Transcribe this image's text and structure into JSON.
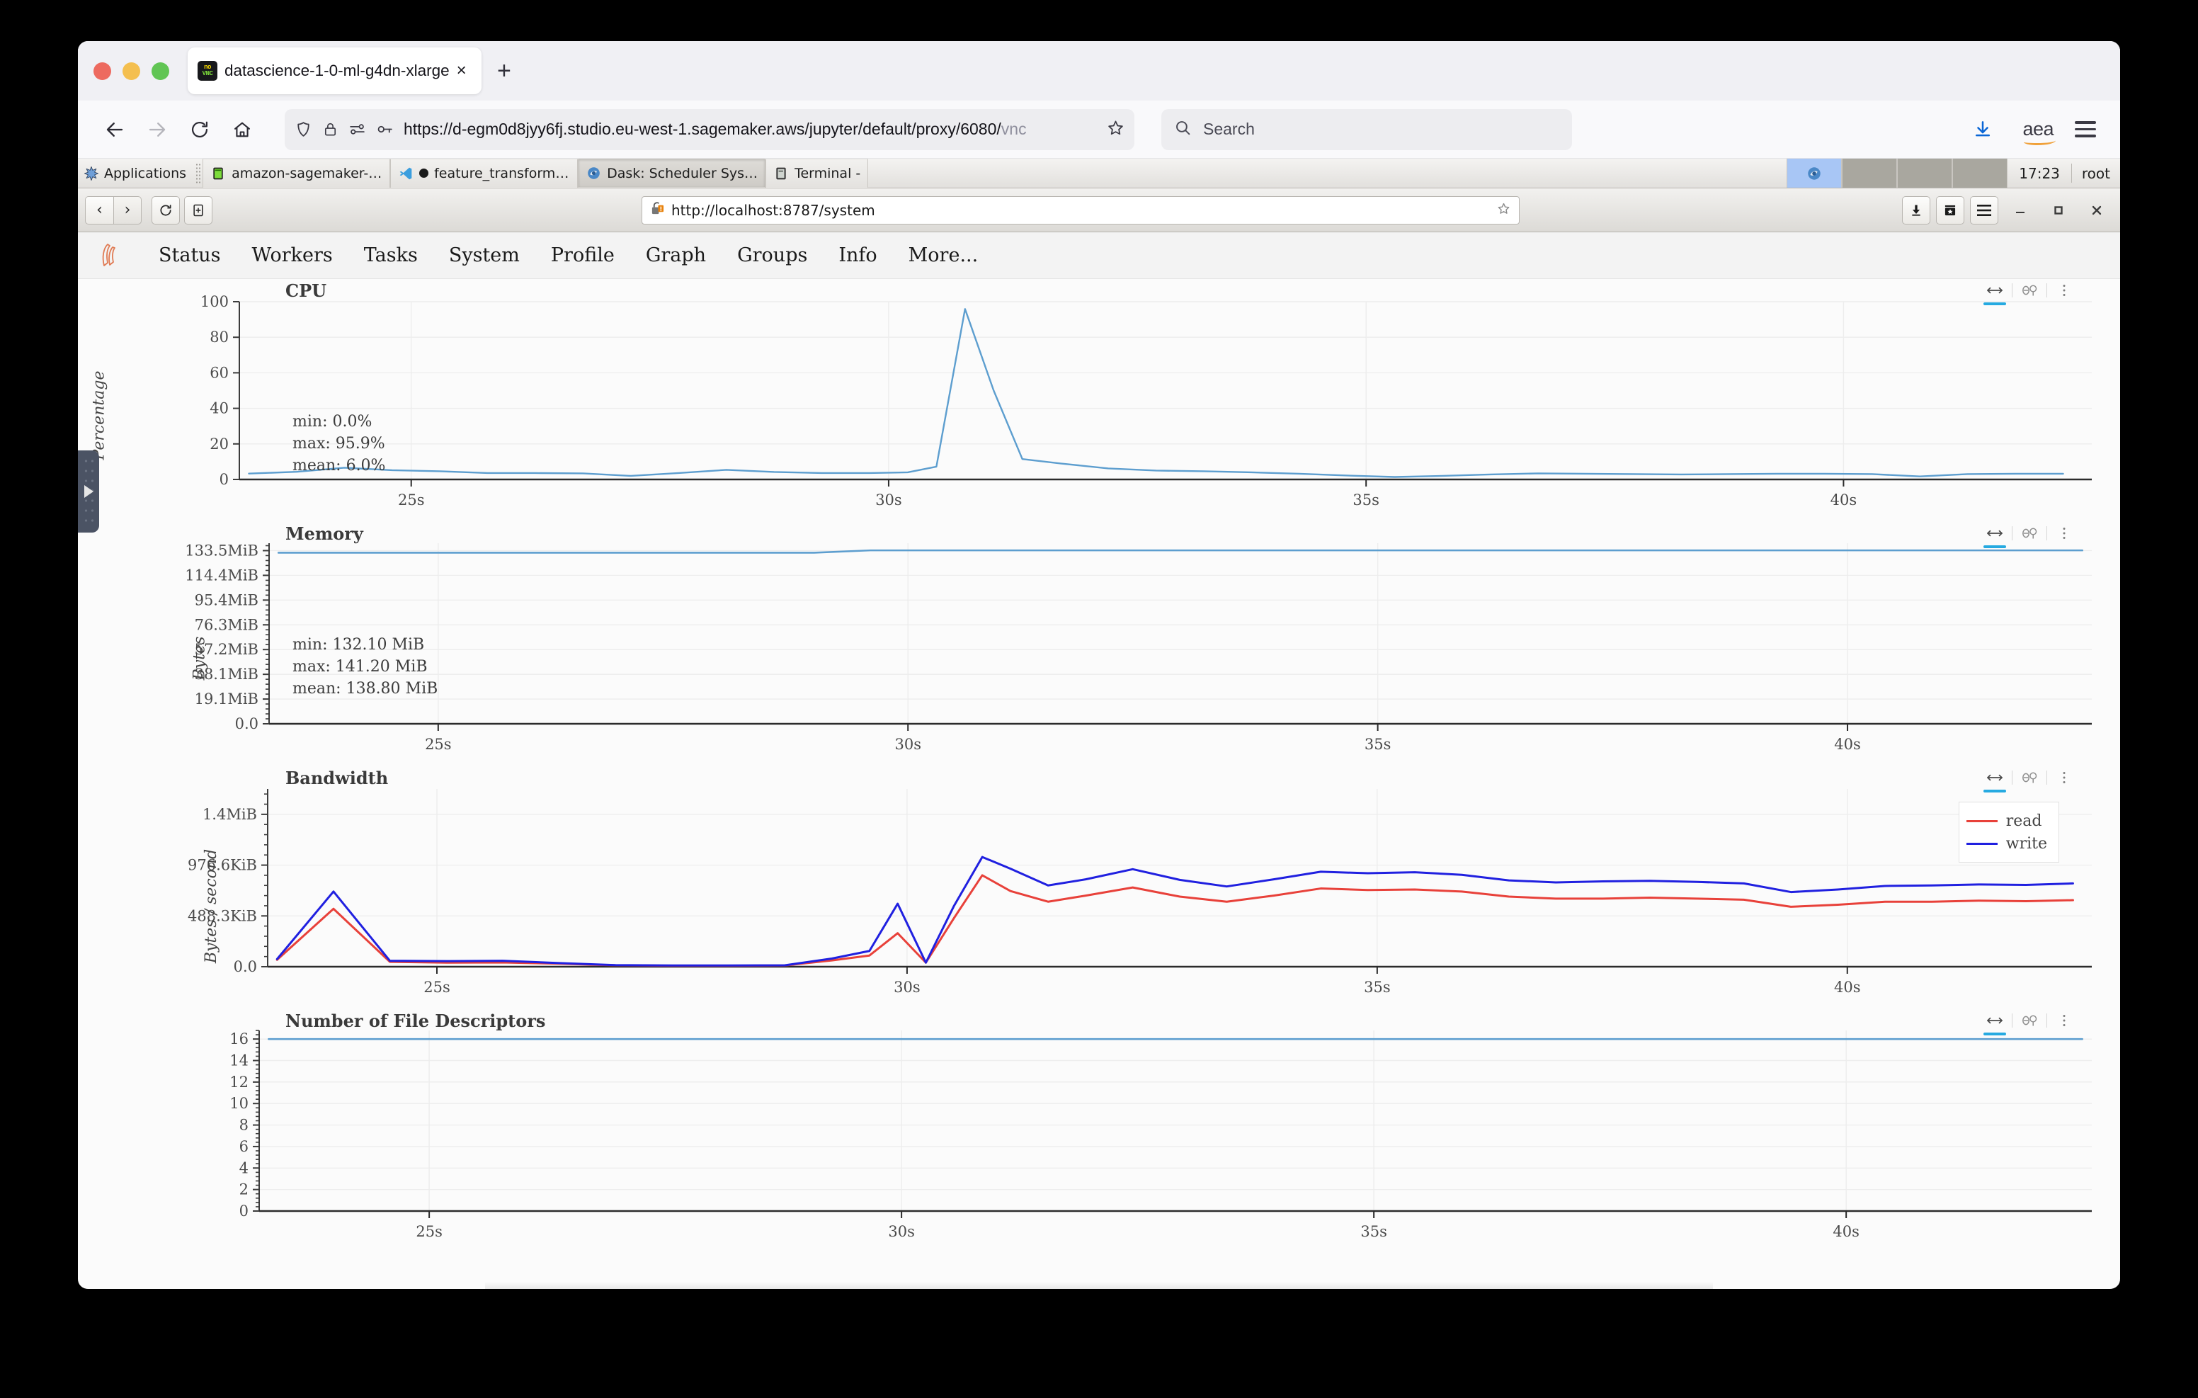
{
  "browser": {
    "tab": {
      "title": "datascience-1-0-ml-g4dn-xlarge",
      "favicon": "novnc-icon",
      "close_label": "×"
    },
    "new_tab_label": "+",
    "nav": {
      "back": "back-icon",
      "forward": "forward-icon",
      "reload": "reload-icon",
      "home": "home-icon"
    },
    "url": {
      "value": "https://d-egm0d8jyy6fj.studio.eu-west-1.sagemaker.aws/jupyter/default/proxy/6080/",
      "value_dim": "vnc",
      "icons": [
        "shield-icon",
        "lock-icon",
        "permissions-icon",
        "key-icon"
      ],
      "bookmark": "star-icon"
    },
    "search": {
      "placeholder": "Search",
      "icon": "search-icon"
    },
    "toolbar_right": {
      "downloads": "download-icon",
      "extension": "aea",
      "menu": "hamburger-icon"
    }
  },
  "desktop": {
    "applications_label": "Applications",
    "tasks": [
      {
        "label": "amazon-sagemaker-exa...",
        "icon": "terminal-icon",
        "active": false
      },
      {
        "label": "feature_transformatio...",
        "icon": "vscode-icon",
        "active": false
      },
      {
        "label": "Dask: Scheduler System...",
        "icon": "firefox-icon",
        "active": true
      },
      {
        "label": "Terminal -",
        "icon": "terminal-icon",
        "active": false
      }
    ],
    "clock": "17:23",
    "user": "root"
  },
  "inner_browser": {
    "buttons": {
      "back": "‹",
      "forward": "›",
      "reload": "↻",
      "new_private": "new-tab-icon",
      "downloads": "download-icon",
      "library": "library-icon",
      "menu": "hamburger-icon",
      "minimize": "minimize-icon",
      "maximize": "maximize-icon",
      "close": "close-icon"
    },
    "url": "http://localhost:8787/system",
    "security_icon": "insecure-lock-icon",
    "bookmark_icon": "star-icon"
  },
  "dask": {
    "logo": "dask-logo",
    "nav_items": [
      "Status",
      "Workers",
      "Tasks",
      "System",
      "Profile",
      "Graph",
      "Groups",
      "Info",
      "More..."
    ],
    "plot_tools": {
      "pan": "pan-tool-icon",
      "reset": "reset-tool-icon",
      "menu": "kebab-menu-icon"
    }
  },
  "chart_data": [
    {
      "type": "line",
      "title": "CPU",
      "xlabel": "",
      "ylabel": "Percentage",
      "ylim": [
        0,
        100
      ],
      "yticks": [
        0,
        20,
        40,
        60,
        80,
        100
      ],
      "ytick_labels": [
        "0",
        "20",
        "40",
        "60",
        "80",
        "100"
      ],
      "xlim": [
        23.2,
        42.6
      ],
      "xticks": [
        25,
        30,
        35,
        40
      ],
      "xtick_labels": [
        "25s",
        "30s",
        "35s",
        "40s"
      ],
      "grid": true,
      "annotations": [
        "min: 0.0%",
        "max: 95.9%",
        "mean: 6.0%"
      ],
      "series": [
        {
          "name": "cpu",
          "color": "#5d9ecf",
          "x": [
            23.3,
            23.8,
            24.3,
            24.8,
            25.3,
            25.8,
            26.3,
            26.8,
            27.3,
            27.8,
            28.3,
            28.8,
            29.3,
            29.8,
            30.2,
            30.5,
            30.8,
            31.1,
            31.4,
            31.8,
            32.3,
            32.8,
            33.3,
            33.8,
            34.3,
            34.8,
            35.3,
            35.8,
            36.3,
            36.8,
            37.3,
            37.8,
            38.3,
            38.8,
            39.3,
            39.8,
            40.3,
            40.8,
            41.3,
            41.8,
            42.3
          ],
          "y": [
            3.3,
            4.3,
            6.6,
            5.2,
            4.6,
            3.6,
            3.6,
            3.4,
            2.0,
            3.6,
            5.4,
            4.2,
            3.6,
            3.6,
            4.0,
            7.2,
            95.9,
            50.0,
            11.5,
            9.0,
            6.2,
            5.0,
            4.6,
            4.0,
            3.2,
            2.2,
            1.4,
            2.0,
            2.8,
            3.4,
            3.2,
            3.0,
            2.8,
            3.0,
            3.2,
            3.2,
            3.0,
            1.7,
            3.0,
            3.2,
            3.2
          ]
        }
      ]
    },
    {
      "type": "line",
      "title": "Memory",
      "xlabel": "",
      "ylabel": "Bytes",
      "ylim": [
        0,
        146000000
      ],
      "yticks": [
        0,
        20000000,
        40000000,
        60000000,
        80000000,
        100000000,
        120000000,
        140000000
      ],
      "ytick_labels": [
        "0.0",
        "19.1MiB",
        "38.1MiB",
        "57.2MiB",
        "76.3MiB",
        "95.4MiB",
        "114.4MiB",
        "133.5MiB"
      ],
      "xticks": [
        25,
        30,
        35,
        40
      ],
      "xtick_labels": [
        "25s",
        "30s",
        "35s",
        "40s"
      ],
      "grid": true,
      "annotations": [
        "min: 132.10 MiB",
        "max: 141.20 MiB",
        "mean: 138.80 MiB"
      ],
      "series": [
        {
          "name": "memory",
          "color": "#5d9ecf",
          "x": [
            23.3,
            29.0,
            29.6,
            42.5
          ],
          "y": [
            138300000,
            138300000,
            140200000,
            140200000
          ]
        }
      ]
    },
    {
      "type": "line",
      "title": "Bandwidth",
      "xlabel": "",
      "ylabel": "Bytes / second",
      "ylim": [
        0,
        1750000
      ],
      "yticks": [
        0,
        500000,
        1000000,
        1500000
      ],
      "ytick_labels": [
        "0.0",
        "488.3KiB",
        "976.6KiB",
        "1.4MiB"
      ],
      "xticks": [
        25,
        30,
        35,
        40
      ],
      "xtick_labels": [
        "25s",
        "30s",
        "35s",
        "40s"
      ],
      "grid": true,
      "legend_position": "top-right",
      "series": [
        {
          "name": "read",
          "color": "#e8413a",
          "x": [
            23.3,
            23.9,
            24.5,
            25.1,
            25.7,
            26.3,
            26.9,
            27.5,
            28.1,
            28.7,
            29.2,
            29.6,
            29.9,
            30.2,
            30.5,
            30.8,
            31.1,
            31.5,
            31.9,
            32.4,
            32.9,
            33.4,
            33.9,
            34.4,
            34.9,
            35.4,
            35.9,
            36.4,
            36.9,
            37.4,
            37.9,
            38.4,
            38.9,
            39.4,
            39.9,
            40.4,
            40.9,
            41.4,
            41.9,
            42.4
          ],
          "y": [
            68000,
            570000,
            48000,
            40000,
            42000,
            30000,
            14000,
            10000,
            10000,
            12000,
            62000,
            110000,
            330000,
            40000,
            480000,
            900000,
            745000,
            640000,
            700000,
            780000,
            690000,
            640000,
            700000,
            770000,
            755000,
            760000,
            740000,
            690000,
            670000,
            670000,
            680000,
            670000,
            660000,
            590000,
            610000,
            640000,
            640000,
            650000,
            645000,
            655000
          ]
        },
        {
          "name": "write",
          "color": "#2020e0",
          "x": [
            23.3,
            23.9,
            24.5,
            25.1,
            25.7,
            26.3,
            26.9,
            27.5,
            28.1,
            28.7,
            29.2,
            29.6,
            29.9,
            30.2,
            30.5,
            30.8,
            31.1,
            31.5,
            31.9,
            32.4,
            32.9,
            33.4,
            33.9,
            34.4,
            34.9,
            35.4,
            35.9,
            36.4,
            36.9,
            37.4,
            37.9,
            38.4,
            38.9,
            39.4,
            39.9,
            40.4,
            40.9,
            41.4,
            41.9,
            42.4
          ],
          "y": [
            75000,
            740000,
            58000,
            55000,
            58000,
            36000,
            16000,
            12000,
            12000,
            14000,
            80000,
            155000,
            620000,
            40000,
            600000,
            1080000,
            965000,
            800000,
            860000,
            960000,
            855000,
            790000,
            860000,
            935000,
            920000,
            930000,
            905000,
            850000,
            830000,
            840000,
            845000,
            835000,
            820000,
            735000,
            760000,
            795000,
            800000,
            810000,
            805000,
            820000
          ]
        }
      ]
    },
    {
      "type": "line",
      "title": "Number of File Descriptors",
      "xlabel": "",
      "ylabel": "",
      "ylim": [
        0,
        16.8
      ],
      "yticks": [
        0,
        2,
        4,
        6,
        8,
        10,
        12,
        14,
        16
      ],
      "ytick_labels": [
        "0",
        "2",
        "4",
        "6",
        "8",
        "10",
        "12",
        "14",
        "16"
      ],
      "xticks": [
        25,
        30,
        35,
        40
      ],
      "xtick_labels": [
        "25s",
        "30s",
        "35s",
        "40s"
      ],
      "grid": true,
      "series": [
        {
          "name": "file_descriptors",
          "color": "#5d9ecf",
          "x": [
            23.3,
            42.5
          ],
          "y": [
            16,
            16
          ]
        }
      ]
    }
  ],
  "legend": {
    "read": "read",
    "write": "write"
  },
  "colors": {
    "line_blue": "#5d9ecf",
    "read_red": "#e8413a",
    "write_blue": "#2020e0",
    "accent": "#26aae1"
  }
}
